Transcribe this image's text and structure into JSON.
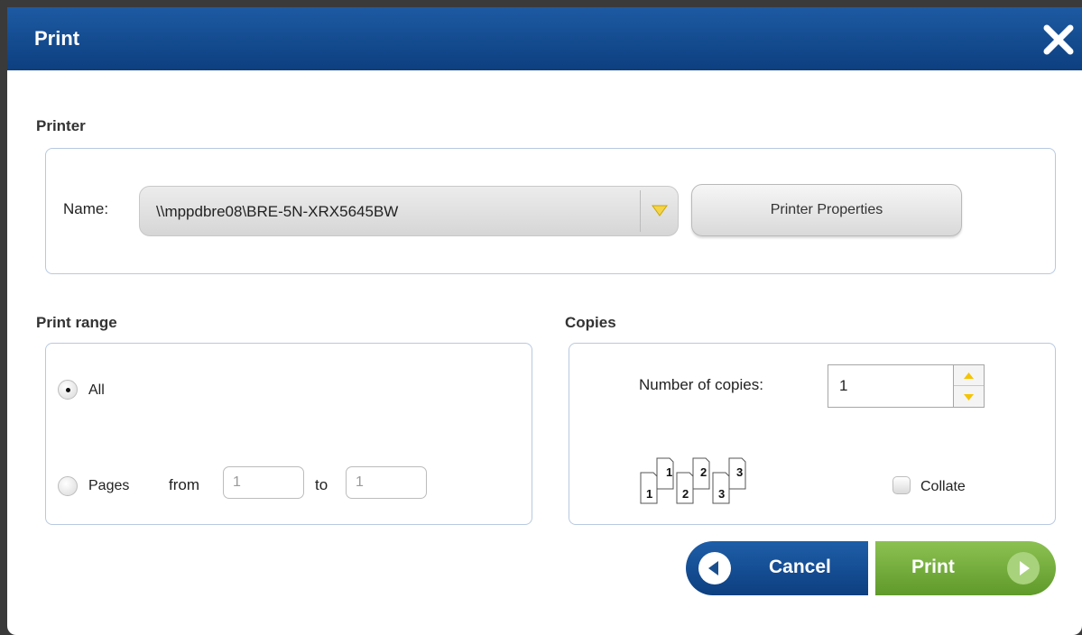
{
  "dialog": {
    "title": "Print",
    "close_icon": "close-icon"
  },
  "printer": {
    "section_label": "Printer",
    "name_label": "Name:",
    "selected_printer": "\\\\mppdbre08\\BRE-5N-XRX5645BW",
    "properties_button": "Printer Properties"
  },
  "print_range": {
    "section_label": "Print range",
    "all_label": "All",
    "all_selected": true,
    "pages_label": "Pages",
    "from_label": "from",
    "from_value": "1",
    "to_label": "to",
    "to_value": "1"
  },
  "copies": {
    "section_label": "Copies",
    "number_label": "Number of copies:",
    "number_value": "1",
    "collate_label": "Collate",
    "collate_checked": false,
    "collate_pages": [
      "1",
      "2",
      "3"
    ]
  },
  "actions": {
    "cancel_label": "Cancel",
    "print_label": "Print"
  },
  "colors": {
    "titlebar": "#0d3f80",
    "cancel": "#1e5ea8",
    "print": "#7ab648",
    "group_border": "#b7c9e0",
    "spinner_arrow": "#f5c400"
  }
}
